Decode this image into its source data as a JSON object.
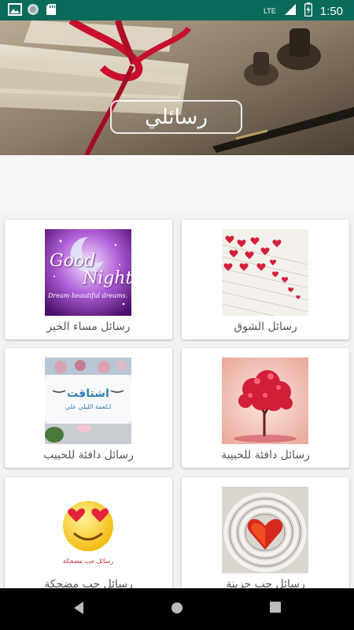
{
  "status_bar": {
    "time": "1:50",
    "network": "LTE",
    "icons": [
      "gallery-notification-icon",
      "circle-notification-icon",
      "sd-card-icon",
      "wifi-icon",
      "signal-icon",
      "battery-charging-icon"
    ]
  },
  "header": {
    "title": "رسائلي"
  },
  "categories": [
    {
      "label": "رسائل الشوق",
      "thumb": "red-hearts-paper"
    },
    {
      "label": "رسائل مساء الخير",
      "thumb": "good-night-moon",
      "thumb_text": {
        "line1": "Good",
        "line2": "Night",
        "line3": "Dream beautiful dreams."
      }
    },
    {
      "label": "رسائل دافئة للحبيبة",
      "thumb": "heart-tree"
    },
    {
      "label": "رسائل دافئة للحبيب",
      "thumb": "pillows-room",
      "thumb_text": {
        "line1": "اشتاقت",
        "line2": "لـلعمة الليلي علي"
      }
    },
    {
      "label": "رسائل حب حزينة",
      "thumb": "heart-music-sheet"
    },
    {
      "label": "رسائل حب مضحكة",
      "thumb": "heart-eyes-emoji",
      "thumb_text": {
        "line1": "رسائل حب مضحكة"
      }
    }
  ],
  "colors": {
    "status_bar": "#0a6b5b",
    "accent_red": "#c8102e"
  }
}
